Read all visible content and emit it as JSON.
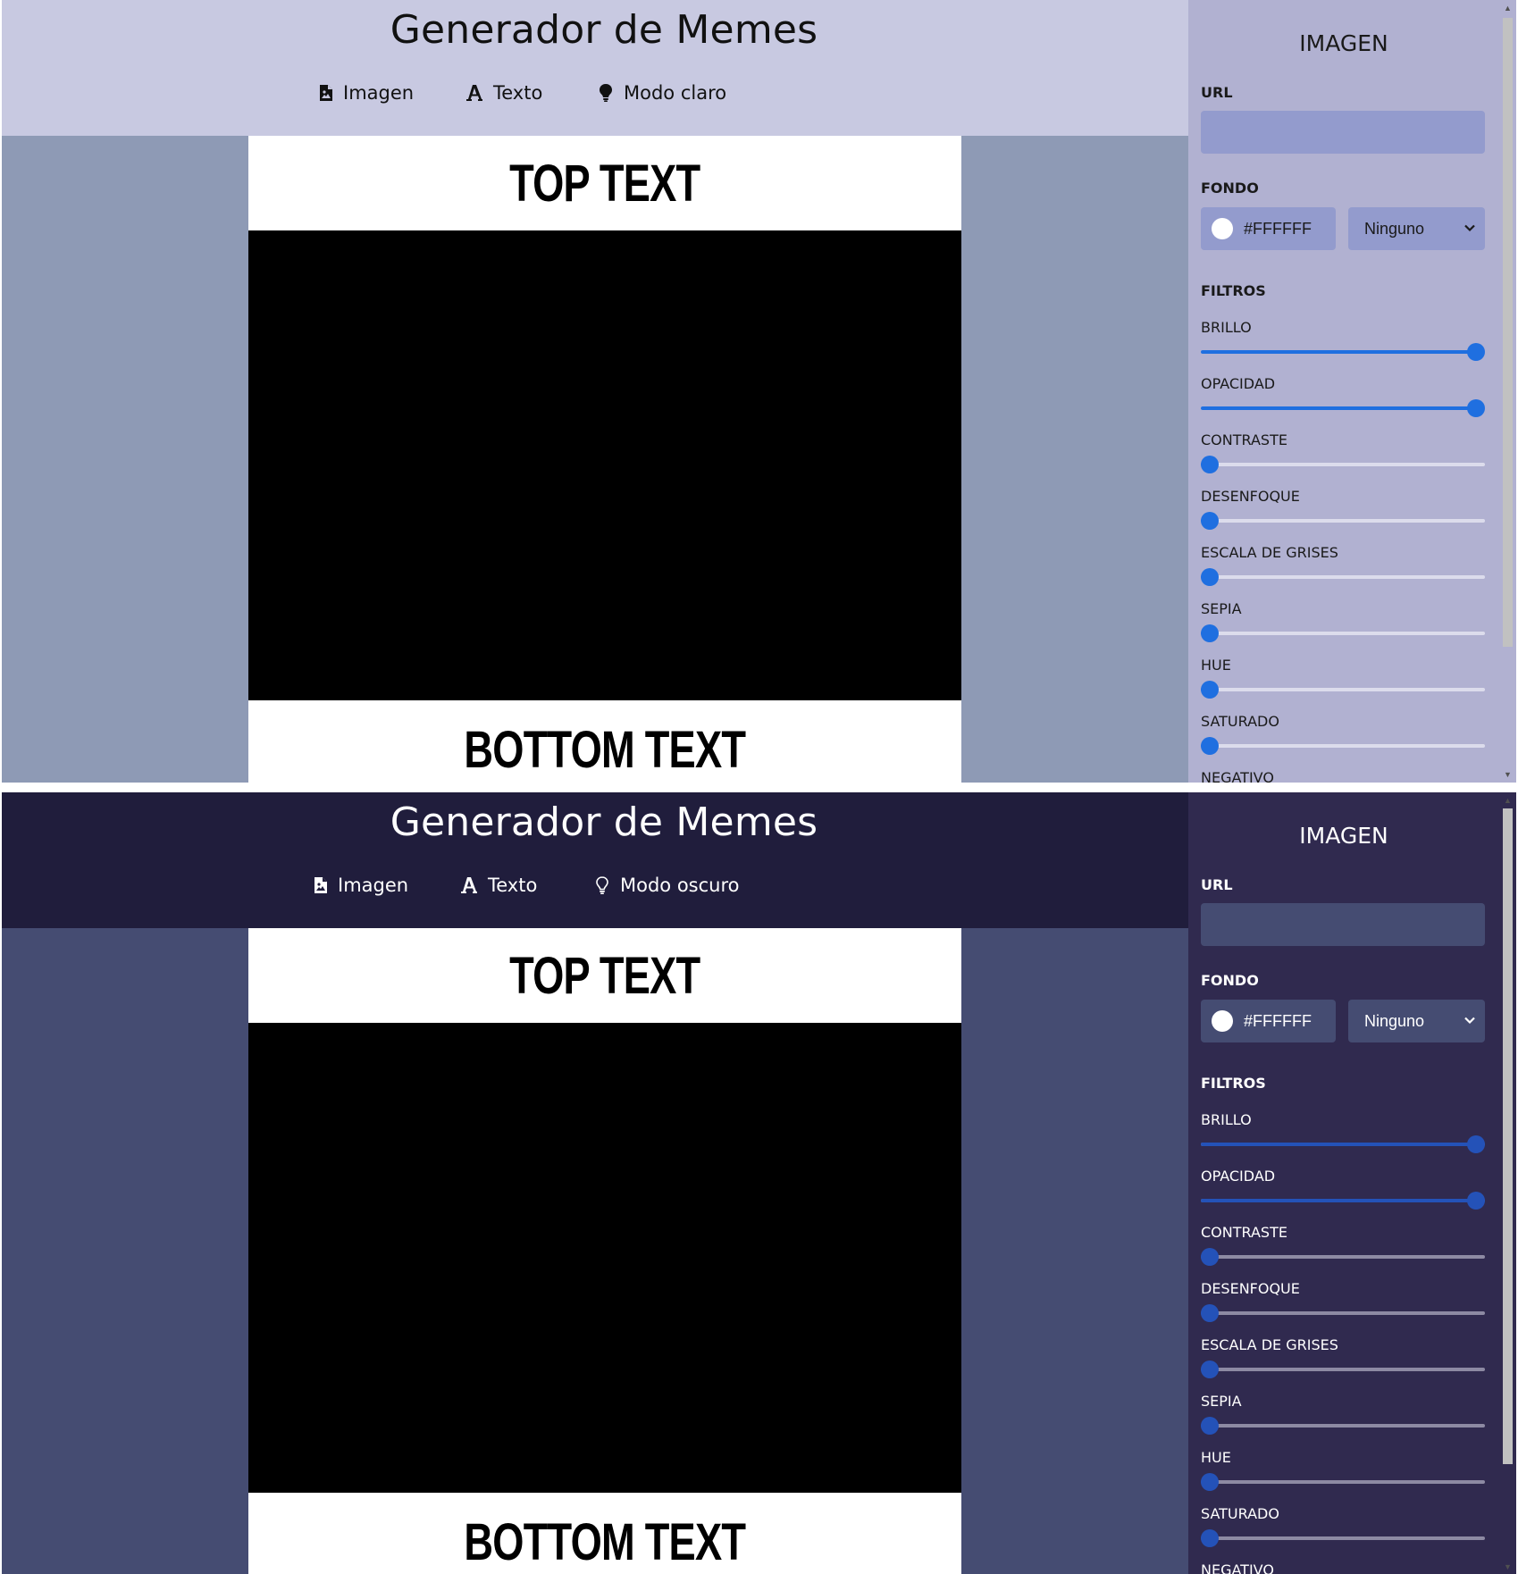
{
  "light": {
    "header": {
      "title": "Generador de Memes"
    },
    "nav": {
      "image": "Imagen",
      "text": "Texto",
      "mode": "Modo claro"
    },
    "meme": {
      "top_text": "TOP TEXT",
      "bottom_text": "BOTTOM TEXT"
    },
    "panel": {
      "title": "IMAGEN",
      "url_label": "URL",
      "url_value": "",
      "background_label": "FONDO",
      "background_color": "#FFFFFF",
      "blend_mode": "Ninguno",
      "filters_label": "FILTROS",
      "filters": [
        {
          "label": "BRILLO",
          "value": 1.0
        },
        {
          "label": "OPACIDAD",
          "value": 1.0
        },
        {
          "label": "CONTRASTE",
          "value": 0.0
        },
        {
          "label": "DESENFOQUE",
          "value": 0.0
        },
        {
          "label": "ESCALA DE GRISES",
          "value": 0.0
        },
        {
          "label": "SEPIA",
          "value": 0.0
        },
        {
          "label": "HUE",
          "value": 0.0
        },
        {
          "label": "SATURADO",
          "value": 0.0
        },
        {
          "label": "NEGATIVO"
        }
      ]
    }
  },
  "dark": {
    "header": {
      "title": "Generador de Memes"
    },
    "nav": {
      "image": "Imagen",
      "text": "Texto",
      "mode": "Modo oscuro"
    },
    "meme": {
      "top_text": "TOP TEXT",
      "bottom_text": "BOTTOM TEXT"
    },
    "panel": {
      "title": "IMAGEN",
      "url_label": "URL",
      "url_value": "",
      "background_label": "FONDO",
      "background_color": "#FFFFFF",
      "blend_mode": "Ninguno",
      "filters_label": "FILTROS",
      "filters": [
        {
          "label": "BRILLO",
          "value": 1.0
        },
        {
          "label": "OPACIDAD",
          "value": 1.0
        },
        {
          "label": "CONTRASTE",
          "value": 0.0
        },
        {
          "label": "DESENFOQUE",
          "value": 0.0
        },
        {
          "label": "ESCALA DE GRISES",
          "value": 0.0
        },
        {
          "label": "SEPIA",
          "value": 0.0
        },
        {
          "label": "HUE",
          "value": 0.0
        },
        {
          "label": "SATURADO",
          "value": 0.0
        },
        {
          "label": "NEGATIVO"
        }
      ]
    }
  },
  "colors": {
    "light_header": "#c8c9e1",
    "light_canvas": "#8e9ab5",
    "light_panel": "#b1b1d1",
    "dark_header": "#201d3c",
    "dark_canvas": "#454c72",
    "dark_panel": "#302a4f",
    "slider_accent_light": "#1f6fe0",
    "slider_accent_dark": "#2452b8"
  },
  "icons": {
    "image": "file-image-icon",
    "text": "font-letter-icon",
    "mode_light": "lightbulb-filled-icon",
    "mode_dark": "lightbulb-outline-icon",
    "select": "chevron-down-icon"
  }
}
